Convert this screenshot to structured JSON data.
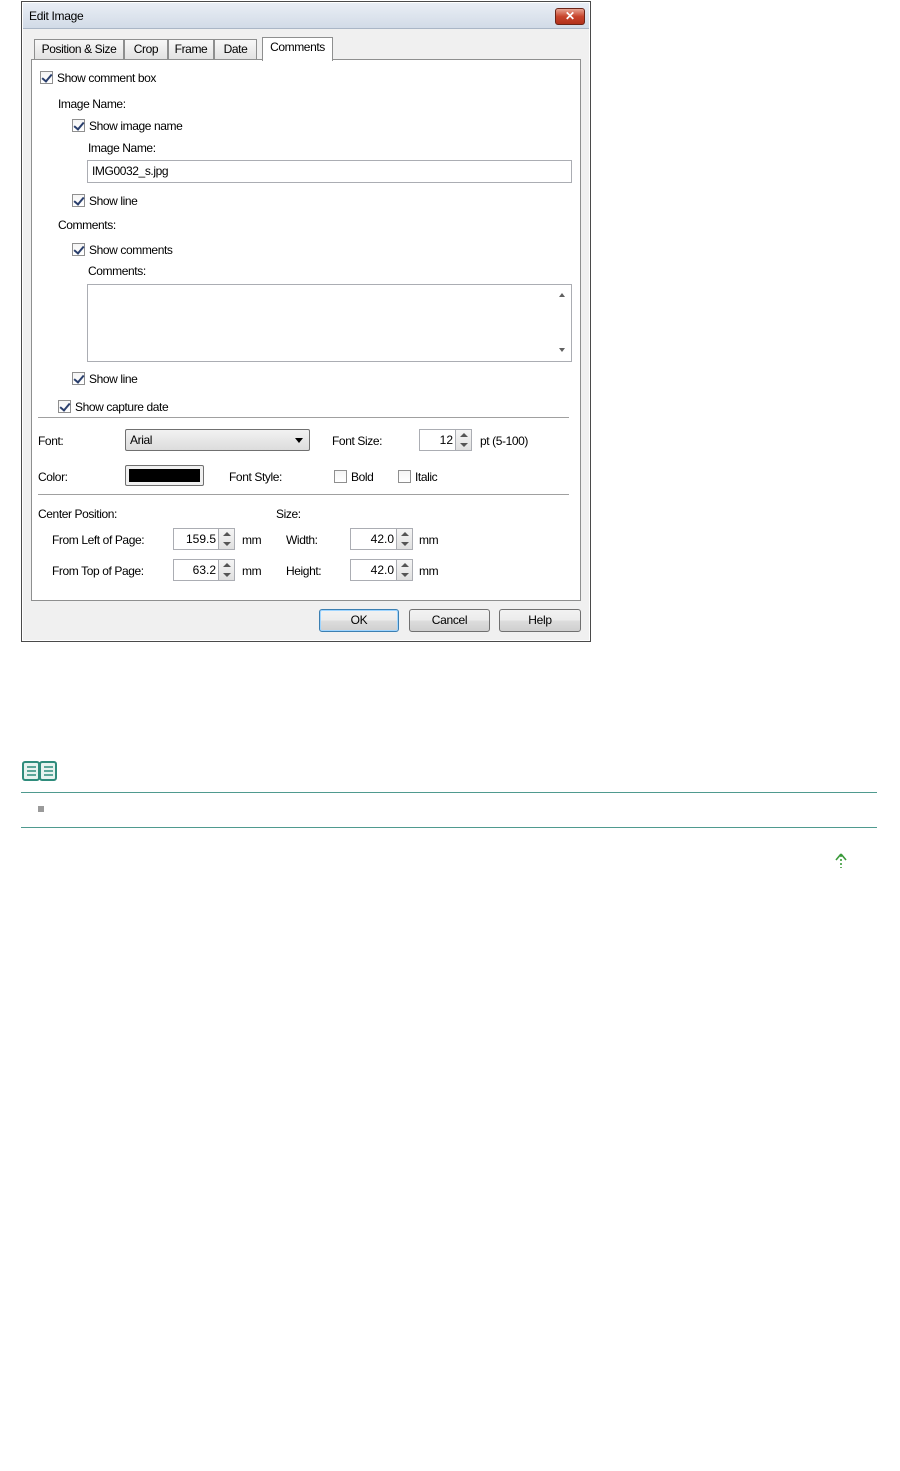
{
  "window": {
    "title": "Edit Image",
    "close_glyph": "✕"
  },
  "tabs": [
    {
      "label": "Position & Size"
    },
    {
      "label": "Crop"
    },
    {
      "label": "Frame"
    },
    {
      "label": "Date"
    },
    {
      "label": "Comments",
      "active": true
    }
  ],
  "comments_tab": {
    "show_comment_box": {
      "label": "Show comment box",
      "checked": true
    },
    "image_name_group": "Image Name:",
    "show_image_name": {
      "label": "Show image name",
      "checked": true
    },
    "image_name_label": "Image Name:",
    "image_name_value": "IMG0032_s.jpg",
    "show_line_1": {
      "label": "Show line",
      "checked": true
    },
    "comments_group": "Comments:",
    "show_comments": {
      "label": "Show comments",
      "checked": true
    },
    "comments_label": "Comments:",
    "comments_value": "",
    "show_line_2": {
      "label": "Show line",
      "checked": true
    },
    "show_capture_date": {
      "label": "Show capture date",
      "checked": true
    }
  },
  "font_section": {
    "font_label": "Font:",
    "font_value": "Arial",
    "font_size_label": "Font Size:",
    "font_size_value": "12",
    "font_size_range": "pt (5-100)",
    "color_label": "Color:",
    "color_value": "#000000",
    "font_style_label": "Font Style:",
    "bold": {
      "label": "Bold",
      "checked": false
    },
    "italic": {
      "label": "Italic",
      "checked": false
    }
  },
  "position_section": {
    "center_position_label": "Center Position:",
    "from_left_label": "From Left of Page:",
    "from_left_value": "159.5",
    "from_top_label": "From Top of Page:",
    "from_top_value": "63.2",
    "unit": "mm",
    "size_label": "Size:",
    "width_label": "Width:",
    "width_value": "42.0",
    "height_label": "Height:",
    "height_value": "42.0"
  },
  "buttons": {
    "ok": "OK",
    "cancel": "Cancel",
    "help": "Help"
  },
  "colors": {
    "note_rule": "#4f9a8f",
    "accent_green": "#3a9a3a"
  }
}
